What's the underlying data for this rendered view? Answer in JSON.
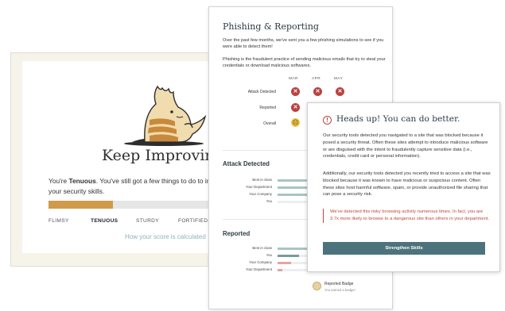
{
  "left_card": {
    "title": "Keep Improving!",
    "score_prefix": "You're ",
    "score_level": "Tenuous",
    "score_suffix": ". You've still got a few things to do to improve your security skills.",
    "progress_fraction": 0.36,
    "levels": [
      "FLIMSY",
      "TENUOUS",
      "STURDY",
      "FORTIFIED"
    ],
    "active_level": "TENUOUS",
    "calc_link": "How your score is calculated"
  },
  "mid_card": {
    "title": "Phishing & Reporting",
    "intro": "Over the past few months, we've sent you a few phishing simulations to see if you were able to detect them!",
    "definition": "Phishing is the fraudulent practice of sending malicious emails that try to steal your credentials or download malicious softwares.",
    "months": [
      "MAR",
      "APR",
      "MAY"
    ],
    "rows": [
      "Attack Detected",
      "Reported",
      "Overall"
    ],
    "attack_section": {
      "title": "Attack Detected",
      "bars": [
        {
          "label": "Best in class",
          "value": 1.0,
          "color": "#a9c4c5"
        },
        {
          "label": "Your Department",
          "value": 0.9,
          "color": "#a9c4c5"
        },
        {
          "label": "Your Company",
          "value": 0.7,
          "color": "#a9c4c5"
        },
        {
          "label": "You",
          "value": 0.0,
          "color": "#a9c4c5"
        }
      ]
    },
    "reported_section": {
      "title": "Reported",
      "bars": [
        {
          "label": "Best in class",
          "value": 1.0,
          "color": "#a9c4c5"
        },
        {
          "label": "You",
          "value": 0.28,
          "color": "#7b9a9c"
        },
        {
          "label": "Your Company",
          "value": 0.18,
          "color": "#e6a3a3"
        },
        {
          "label": "Your Department",
          "value": 0.06,
          "color": "#e6a3a3"
        }
      ]
    },
    "badge": {
      "title": "Reported Badge",
      "subtitle": "You earned a badge!"
    }
  },
  "right_card": {
    "title": "Heads up! You can do better.",
    "p1": "Our security tools detected you navigated to a site that was blocked because it posed a security threat. Often these sites attempt to introduce malicious software or are disguised with the intent to fraudulently capture sensitive data (i.e., credentials, credit card or personal information).",
    "p2": "Additionally, our security tools detected you recently tried to access a site that was blocked because it was known to have malicious or suspicious content. Often these sites host harmful software, spam, or provide unauthorized file sharing that can pose a security risk.",
    "alert": "We've detected this risky browsing activity numerous times. In fact, you are 3.7x more likely to browse to a dangerous site than others in your department.",
    "cta": "Strengthen Skills"
  },
  "colors": {
    "accent_orange": "#cf9a4a",
    "danger_red": "#c0463f",
    "teal_button": "#4c737b"
  }
}
